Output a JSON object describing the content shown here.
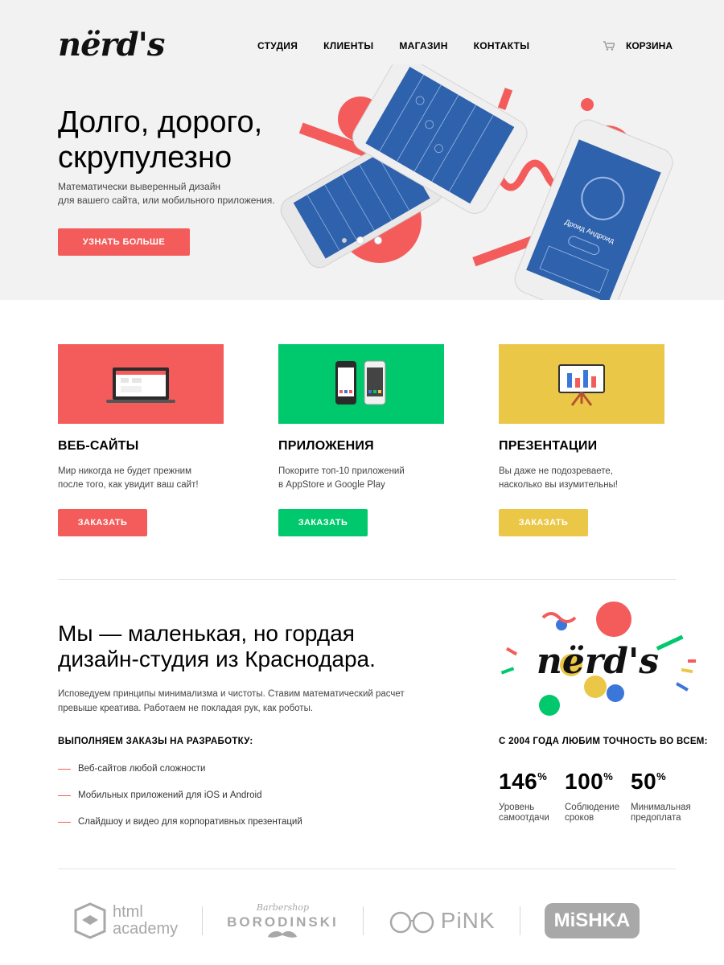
{
  "header": {
    "logo": "nërd's",
    "nav": [
      "СТУДИЯ",
      "КЛИЕНТЫ",
      "МАГАЗИН",
      "КОНТАКТЫ"
    ],
    "cart_label": "КОРЗИНА"
  },
  "hero": {
    "title_line1": "Долго, дорого,",
    "title_line2": "скрупулезно",
    "subtitle_line1": "Математически выверенный дизайн",
    "subtitle_line2": "для вашего сайта, или мобильного приложения.",
    "button": "УЗНАТЬ БОЛЬШЕ",
    "phone_caption": "Дроид Андроид"
  },
  "services": [
    {
      "title": "ВЕБ-САЙТЫ",
      "text_line1": "Мир никогда не будет прежним",
      "text_line2": "после того, как увидит ваш сайт!",
      "button": "ЗАКАЗАТЬ",
      "color": "#f45c5c"
    },
    {
      "title": "ПРИЛОЖЕНИЯ",
      "text_line1": "Покорите топ-10 приложений",
      "text_line2": "в AppStore и Google Play",
      "button": "ЗАКАЗАТЬ",
      "color": "#00c86c"
    },
    {
      "title": "ПРЕЗЕНТАЦИИ",
      "text_line1": "Вы даже не подозреваете,",
      "text_line2": "насколько вы изумительны!",
      "button": "ЗАКАЗАТЬ",
      "color": "#ebc747"
    }
  ],
  "about": {
    "title_line1": "Мы — маленькая, но гордая",
    "title_line2": "дизайн-студия из Краснодара.",
    "text_line1": "Исповедуем принципы минимализма и чистоты. Ставим математический расчет",
    "text_line2": "превыше креатива. Работаем не покладая рук, как роботы.",
    "list_title": "ВЫПОЛНЯЕМ ЗАКАЗЫ НА РАЗРАБОТКУ:",
    "list": [
      "Веб-сайтов любой сложности",
      "Мобильных приложений для iOS и Android",
      "Слайдшоу и видео для корпоративных презентаций"
    ],
    "logo": "nërd's"
  },
  "stats": {
    "title": "С 2004 ГОДА ЛЮБИМ ТОЧНОСТЬ ВО ВСЕМ:",
    "items": [
      {
        "value": "146",
        "unit": "%",
        "label_line1": "Уровень",
        "label_line2": "самоотдачи"
      },
      {
        "value": "100",
        "unit": "%",
        "label_line1": "Соблюдение",
        "label_line2": "сроков"
      },
      {
        "value": "50",
        "unit": "%",
        "label_line1": "Минимальная",
        "label_line2": "предоплата"
      }
    ]
  },
  "partners": {
    "academy_line1": "html",
    "academy_line2": "academy",
    "barber_top": "Barbershop",
    "barber_name": "BORODINSKI",
    "pink": "PiNK",
    "mishka": "MiSHKA"
  },
  "colors": {
    "accent_red": "#f45c5c",
    "accent_green": "#00c86c",
    "accent_yellow": "#ebc747",
    "hero_bg": "#f2f2f2",
    "phone_screen": "#2f62ad"
  }
}
